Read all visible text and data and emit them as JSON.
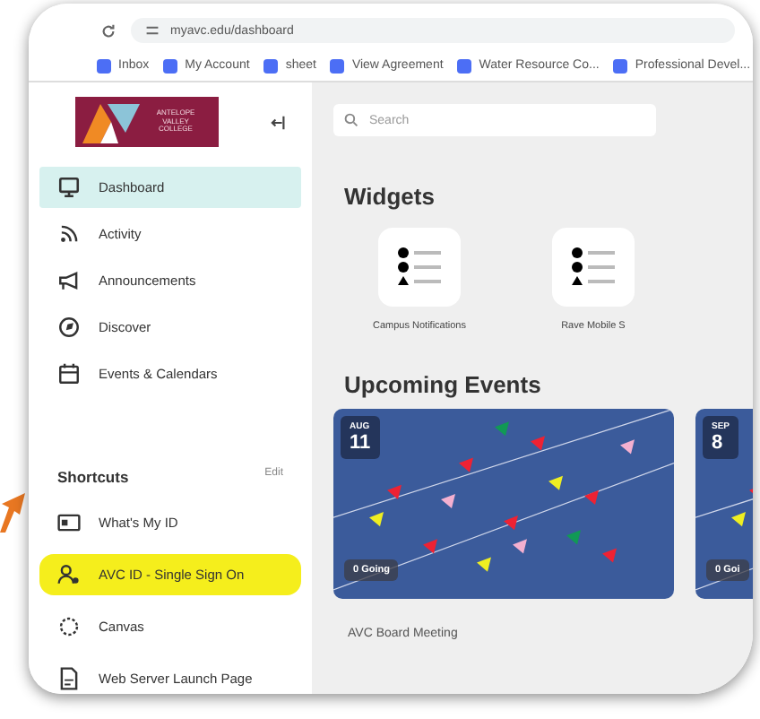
{
  "browser": {
    "url": "myavc.edu/dashboard",
    "bookmarks": [
      "Inbox",
      "My Account",
      "sheet",
      "View Agreement",
      "Water Resource Co...",
      "Professional Devel..."
    ]
  },
  "sidebar": {
    "logo_text": "ANTELOPE VALLEY COLLEGE",
    "nav": [
      {
        "label": "Dashboard",
        "kind": "dashboard",
        "selected": true
      },
      {
        "label": "Activity",
        "kind": "feed",
        "selected": false
      },
      {
        "label": "Announcements",
        "kind": "megaphone",
        "selected": false
      },
      {
        "label": "Discover",
        "kind": "compass",
        "selected": false
      },
      {
        "label": "Events & Calendars",
        "kind": "calendar",
        "selected": false
      }
    ],
    "shortcuts": {
      "title": "Shortcuts",
      "action": "Edit",
      "items": [
        {
          "label": "What's My ID",
          "kind": "idcard",
          "highlighted": false
        },
        {
          "label": "AVC ID - Single Sign On",
          "kind": "user",
          "highlighted": true
        },
        {
          "label": "Canvas",
          "kind": "canvas",
          "highlighted": false
        },
        {
          "label": "Web Server Launch Page",
          "kind": "page",
          "highlighted": false
        }
      ]
    }
  },
  "main": {
    "search": {
      "placeholder": "Search"
    },
    "widgets_title": "Widgets",
    "widgets": [
      {
        "label": "Campus Notifications"
      },
      {
        "label": "Rave Mobile S"
      }
    ],
    "events_title": "Upcoming Events",
    "events": [
      {
        "month": "AUG",
        "day": "11",
        "going": "0 Going",
        "title": "AVC Board Meeting"
      },
      {
        "month": "SEP",
        "day": "8",
        "going": "0 Goi"
      }
    ]
  }
}
